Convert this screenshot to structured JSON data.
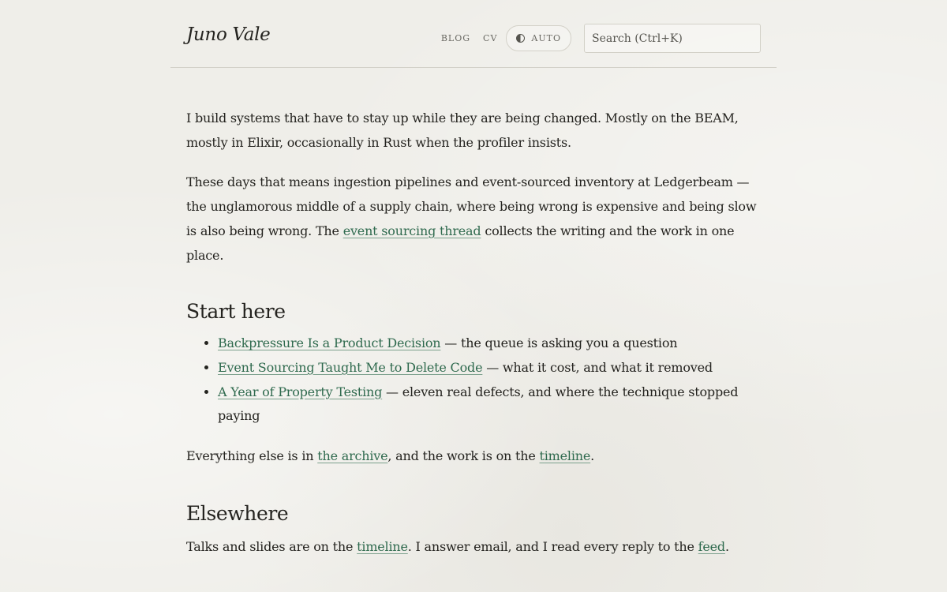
{
  "header": {
    "site_title": "Juno Vale",
    "nav": {
      "blog": "BLOG",
      "cv": "CV"
    },
    "theme_toggle": {
      "label": "AUTO",
      "icon": "half-circle-icon"
    },
    "search": {
      "placeholder": "Search (Ctrl+K)",
      "value": ""
    }
  },
  "intro": {
    "p1": "I build systems that have to stay up while they are being changed. Mostly on the BEAM, mostly in Elixir, occasionally in Rust when the profiler insists.",
    "p2_before": "These days that means ingestion pipelines and event-sourced inventory at Ledgerbeam — the unglamorous middle of a supply chain, where being wrong is expensive and being slow is also being wrong. The ",
    "p2_link": "event sourcing thread",
    "p2_after": " collects the writing and the work in one place."
  },
  "start_here": {
    "heading": "Start here",
    "items": [
      {
        "title": "Backpressure Is a Product Decision",
        "desc": " — the queue is asking you a question"
      },
      {
        "title": "Event Sourcing Taught Me to Delete Code",
        "desc": " — what it cost, and what it removed"
      },
      {
        "title": "A Year of Property Testing",
        "desc": " — eleven real defects, and where the technique stopped paying"
      }
    ],
    "archive_before": "Everything else is in ",
    "archive_link": "the archive",
    "archive_middle": ", and the work is on the ",
    "timeline_link": "timeline",
    "archive_after": "."
  },
  "elsewhere": {
    "heading": "Elsewhere",
    "text_before": "Talks and slides are on the ",
    "timeline_link": "timeline",
    "text_middle": ". I answer email, and I read every reply to the ",
    "feed_link": "feed",
    "text_after": "."
  },
  "colors": {
    "background": "#efeee9",
    "text": "#24231f",
    "link": "#2f6a4e",
    "muted": "#6a6963",
    "border": "#d3d1c8"
  }
}
